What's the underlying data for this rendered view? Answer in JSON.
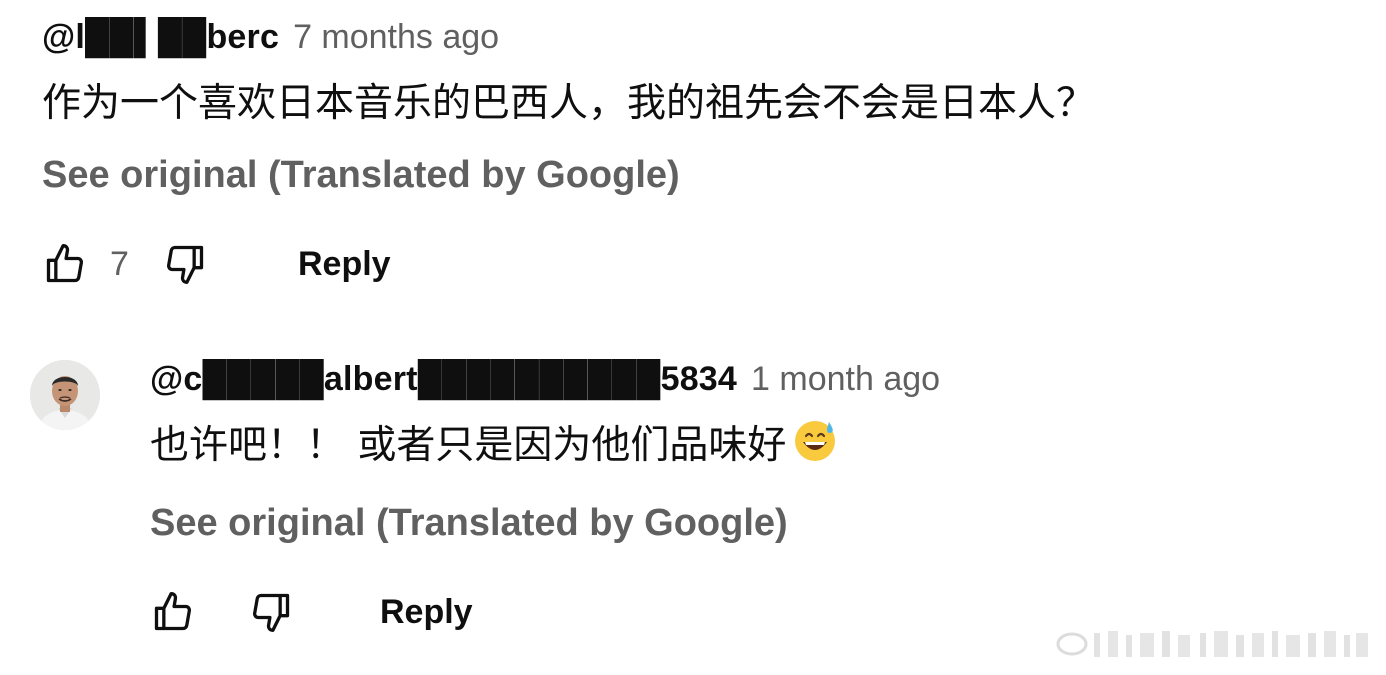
{
  "comments": [
    {
      "author": "@l██▌██berc",
      "time": "7 months ago",
      "text": "作为一个喜欢日本音乐的巴西人，我的祖先会不会是日本人？",
      "see_original": "See original (Translated by Google)",
      "likes": "7",
      "reply_label": "Reply"
    },
    {
      "author": "@c█████albert██████████5834",
      "time": "1 month ago",
      "text": "也许吧！！ 或者只是因为他们品味好",
      "see_original": "See original (Translated by Google)",
      "likes": "",
      "reply_label": "Reply"
    }
  ],
  "icons": {
    "like": "thumbs-up-icon",
    "dislike": "thumbs-down-icon",
    "emoji": "grinning-sweat-emoji"
  },
  "colors": {
    "text": "#0f0f0f",
    "secondary": "#606060",
    "background": "#ffffff"
  }
}
